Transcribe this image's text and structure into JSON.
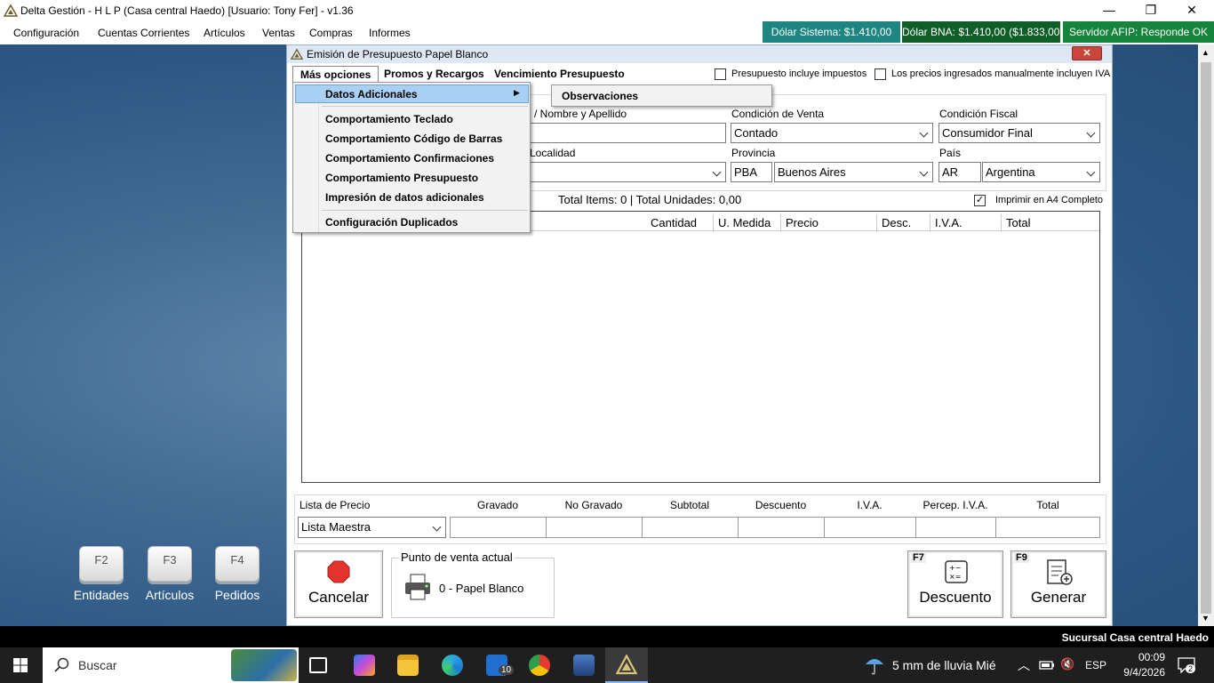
{
  "titlebar": {
    "title": "Delta Gestión - H L P (Casa central Haedo) [Usuario: Tony Fer] - v1.36",
    "minimize": "—",
    "maximize": "❐",
    "close": "✕"
  },
  "menu": [
    "Configuración",
    "Cuentas Corrientes",
    "Artículos",
    "Ventas",
    "Compras",
    "Informes"
  ],
  "badges": {
    "dolar_sistema": "Dólar Sistema: $1.410,00",
    "dolar_bna": "Dólar BNA: $1.410,00 ($1.833,00)",
    "afip": "Servidor AFIP:  Responde OK"
  },
  "colors": {
    "badge_teal": "#1e8580",
    "badge_green1": "#0f5e28",
    "badge_green2": "#16843a",
    "stop_red": "#e0342c"
  },
  "fkeys": [
    {
      "key": "F2",
      "label": "Entidades"
    },
    {
      "key": "F3",
      "label": "Artículos"
    },
    {
      "key": "F4",
      "label": "Pedidos"
    }
  ],
  "window": {
    "title": "Emisión de Presupuesto Papel Blanco",
    "close": "✕",
    "tabs": [
      "Más opciones",
      "Promos y Recargos",
      "Vencimiento Presupuesto"
    ],
    "check_impuestos": "Presupuesto incluye impuestos",
    "check_iva": "Los precios ingresados manualmente incluyen IVA",
    "fields": {
      "nombre_label": "/ Nombre y Apellido",
      "condicion_venta_label": "Condición de Venta",
      "condicion_venta_value": "Contado",
      "condicion_fiscal_label": "Condición Fiscal",
      "condicion_fiscal_value": "Consumidor Final",
      "localidad_label": "Localidad",
      "provincia_label": "Provincia",
      "provincia_code": "PBA",
      "provincia_value": "Buenos Aires",
      "pais_label": "País",
      "pais_code": "AR",
      "pais_value": "Argentina"
    },
    "totals_line": "Total Items: 0  |  Total Unidades: 0,00",
    "check_a4": "Imprimir en A4 Completo",
    "columns": [
      "Cantidad",
      "U. Medida",
      "Precio",
      "Desc.",
      "I.V.A.",
      "Total"
    ],
    "footer_labels": [
      "Lista de Precio",
      "Gravado",
      "No Gravado",
      "Subtotal",
      "Descuento",
      "I.V.A.",
      "Percep. I.V.A.",
      "Total"
    ],
    "lista_precio_value": "Lista Maestra",
    "cancel_label": "Cancelar",
    "punto_venta_label": "Punto de venta actual",
    "punto_venta_value": "0 - Papel Blanco",
    "descuento_key": "F7",
    "descuento_label": "Descuento",
    "generar_key": "F9",
    "generar_label": "Generar"
  },
  "dropdown": {
    "items": [
      "Datos Adicionales",
      "Comportamiento Teclado",
      "Comportamiento Código de Barras",
      "Comportamiento Confirmaciones",
      "Comportamiento Presupuesto",
      "Impresión de datos adicionales",
      "Configuración Duplicados"
    ],
    "submenu": [
      "Observaciones"
    ]
  },
  "statusbar": "Sucursal Casa central Haedo",
  "taskbar": {
    "search_placeholder": "Buscar",
    "mail_badge": "10",
    "weather": "5 mm de lluvia Mié",
    "lang": "ESP",
    "time": "00:09",
    "date": "9/4/2026",
    "notif": "2"
  }
}
